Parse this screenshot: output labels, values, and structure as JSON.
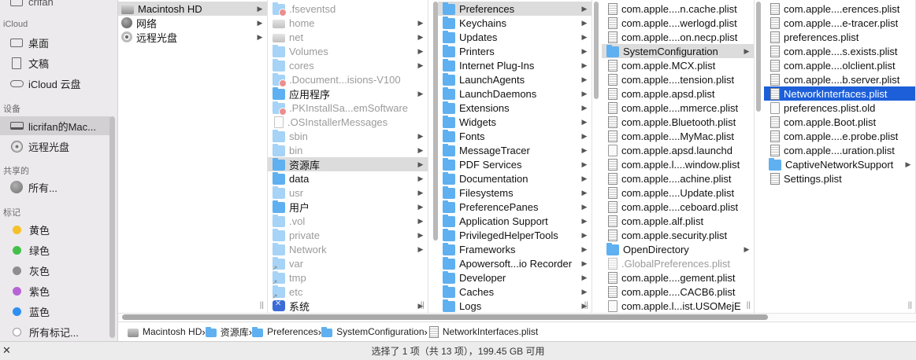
{
  "sidebar": {
    "top_partial": "crifan",
    "icloud_heading": "iCloud",
    "icloud": [
      {
        "label": "桌面",
        "icon": "desktop-icon"
      },
      {
        "label": "文稿",
        "icon": "document-icon"
      },
      {
        "label": "iCloud 云盘",
        "icon": "cloud-icon"
      }
    ],
    "devices_heading": "设备",
    "devices": [
      {
        "label": "licrifan的Mac...",
        "icon": "laptop-icon"
      },
      {
        "label": "远程光盘",
        "icon": "disc-icon"
      }
    ],
    "shared_heading": "共享的",
    "shared": [
      {
        "label": "所有...",
        "icon": "network-icon"
      }
    ],
    "tags_heading": "标记",
    "tags": [
      {
        "label": "黄色",
        "color": "#f6c02a"
      },
      {
        "label": "绿色",
        "color": "#44c04a"
      },
      {
        "label": "灰色",
        "color": "#8e8e8e"
      },
      {
        "label": "紫色",
        "color": "#b763d6"
      },
      {
        "label": "蓝色",
        "color": "#2f8ff2"
      },
      {
        "label": "所有标记...",
        "color": ""
      }
    ]
  },
  "columns": [
    {
      "items": [
        {
          "name": "Macintosh HD",
          "icon": "disk",
          "arrow": true,
          "selected": "gray"
        },
        {
          "name": "网络",
          "icon": "network",
          "arrow": true
        },
        {
          "name": "远程光盘",
          "icon": "disc",
          "arrow": true
        }
      ]
    },
    {
      "items": [
        {
          "name": ".fseventsd",
          "icon": "folder-lock",
          "dim": true
        },
        {
          "name": "home",
          "icon": "disk",
          "dim": true,
          "arrow": true
        },
        {
          "name": "net",
          "icon": "disk",
          "dim": true,
          "arrow": true
        },
        {
          "name": "Volumes",
          "icon": "folder",
          "dim": true,
          "arrow": true
        },
        {
          "name": "cores",
          "icon": "folder",
          "dim": true,
          "arrow": true
        },
        {
          "name": ".Document...isions-V100",
          "icon": "folder-lock",
          "dim": true
        },
        {
          "name": "应用程序",
          "icon": "folder",
          "arrow": true
        },
        {
          "name": ".PKInstallSa...emSoftware",
          "icon": "folder-lock",
          "dim": true
        },
        {
          "name": ".OSInstallerMessages",
          "icon": "file",
          "dim": true
        },
        {
          "name": "sbin",
          "icon": "folder",
          "dim": true,
          "arrow": true
        },
        {
          "name": "bin",
          "icon": "folder",
          "dim": true,
          "arrow": true
        },
        {
          "name": "资源库",
          "icon": "folder",
          "arrow": true,
          "selected": "gray"
        },
        {
          "name": "data",
          "icon": "folder",
          "arrow": true
        },
        {
          "name": "usr",
          "icon": "folder",
          "dim": true,
          "arrow": true
        },
        {
          "name": "用户",
          "icon": "folder",
          "arrow": true
        },
        {
          "name": ".vol",
          "icon": "folder",
          "dim": true,
          "arrow": true
        },
        {
          "name": "private",
          "icon": "folder",
          "dim": true,
          "arrow": true
        },
        {
          "name": "Network",
          "icon": "folder",
          "dim": true,
          "arrow": true
        },
        {
          "name": "var",
          "icon": "alias",
          "dim": true
        },
        {
          "name": "tmp",
          "icon": "alias",
          "dim": true
        },
        {
          "name": "etc",
          "icon": "alias",
          "dim": true
        },
        {
          "name": "系统",
          "icon": "system",
          "arrow": true
        }
      ]
    },
    {
      "items": [
        {
          "name": "Preferences",
          "icon": "folder",
          "arrow": true,
          "selected": "gray"
        },
        {
          "name": "Keychains",
          "icon": "folder",
          "arrow": true
        },
        {
          "name": "Updates",
          "icon": "folder",
          "arrow": true
        },
        {
          "name": "Printers",
          "icon": "folder",
          "arrow": true
        },
        {
          "name": "Internet Plug-Ins",
          "icon": "folder",
          "arrow": true
        },
        {
          "name": "LaunchAgents",
          "icon": "folder",
          "arrow": true
        },
        {
          "name": "LaunchDaemons",
          "icon": "folder",
          "arrow": true
        },
        {
          "name": "Extensions",
          "icon": "folder",
          "arrow": true
        },
        {
          "name": "Widgets",
          "icon": "folder",
          "arrow": true
        },
        {
          "name": "Fonts",
          "icon": "folder",
          "arrow": true
        },
        {
          "name": "MessageTracer",
          "icon": "folder",
          "arrow": true
        },
        {
          "name": "PDF Services",
          "icon": "folder",
          "arrow": true
        },
        {
          "name": "Documentation",
          "icon": "folder",
          "arrow": true
        },
        {
          "name": "Filesystems",
          "icon": "folder",
          "arrow": true
        },
        {
          "name": "PreferencePanes",
          "icon": "folder",
          "arrow": true
        },
        {
          "name": "Application Support",
          "icon": "folder",
          "arrow": true
        },
        {
          "name": "PrivilegedHelperTools",
          "icon": "folder",
          "arrow": true
        },
        {
          "name": "Frameworks",
          "icon": "folder",
          "arrow": true
        },
        {
          "name": "Apowersoft...io Recorder",
          "icon": "folder",
          "arrow": true
        },
        {
          "name": "Developer",
          "icon": "folder",
          "arrow": true
        },
        {
          "name": "Caches",
          "icon": "folder",
          "arrow": true
        },
        {
          "name": "Logs",
          "icon": "folder",
          "arrow": true
        }
      ]
    },
    {
      "items": [
        {
          "name": "com.apple....n.cache.plist",
          "icon": "plist"
        },
        {
          "name": "com.apple....werlogd.plist",
          "icon": "plist"
        },
        {
          "name": "com.apple....on.necp.plist",
          "icon": "plist"
        },
        {
          "name": "SystemConfiguration",
          "icon": "folder",
          "arrow": true,
          "selected": "gray"
        },
        {
          "name": "com.apple.MCX.plist",
          "icon": "plist"
        },
        {
          "name": "com.apple....tension.plist",
          "icon": "plist"
        },
        {
          "name": "com.apple.apsd.plist",
          "icon": "plist"
        },
        {
          "name": "com.apple....mmerce.plist",
          "icon": "plist"
        },
        {
          "name": "com.apple.Bluetooth.plist",
          "icon": "plist"
        },
        {
          "name": "com.apple....MyMac.plist",
          "icon": "plist"
        },
        {
          "name": "com.apple.apsd.launchd",
          "icon": "file"
        },
        {
          "name": "com.apple.l....window.plist",
          "icon": "plist"
        },
        {
          "name": "com.apple....achine.plist",
          "icon": "plist"
        },
        {
          "name": "com.apple....Update.plist",
          "icon": "plist"
        },
        {
          "name": "com.apple....ceboard.plist",
          "icon": "plist"
        },
        {
          "name": "com.apple.alf.plist",
          "icon": "plist"
        },
        {
          "name": "com.apple.security.plist",
          "icon": "plist"
        },
        {
          "name": "OpenDirectory",
          "icon": "folder",
          "arrow": true
        },
        {
          "name": ".GlobalPreferences.plist",
          "icon": "plist",
          "dim": true
        },
        {
          "name": "com.apple....gement.plist",
          "icon": "plist"
        },
        {
          "name": "com.apple....CACB6.plist",
          "icon": "plist"
        },
        {
          "name": "com.apple.l...ist.USOMejE",
          "icon": "file"
        }
      ]
    },
    {
      "items": [
        {
          "name": "com.apple....erences.plist",
          "icon": "plist"
        },
        {
          "name": "com.apple....e-tracer.plist",
          "icon": "plist"
        },
        {
          "name": "preferences.plist",
          "icon": "plist"
        },
        {
          "name": "com.apple....s.exists.plist",
          "icon": "plist"
        },
        {
          "name": "com.apple....olclient.plist",
          "icon": "plist"
        },
        {
          "name": "com.apple....b.server.plist",
          "icon": "plist"
        },
        {
          "name": "NetworkInterfaces.plist",
          "icon": "plist",
          "selected": "blue"
        },
        {
          "name": "preferences.plist.old",
          "icon": "file"
        },
        {
          "name": "com.apple.Boot.plist",
          "icon": "plist"
        },
        {
          "name": "com.apple....e.probe.plist",
          "icon": "plist"
        },
        {
          "name": "com.apple....uration.plist",
          "icon": "plist"
        },
        {
          "name": "CaptiveNetworkSupport",
          "icon": "folder",
          "arrow": true
        },
        {
          "name": "Settings.plist",
          "icon": "plist"
        }
      ]
    }
  ],
  "pathbar": [
    {
      "label": "Macintosh HD",
      "icon": "disk"
    },
    {
      "label": "资源库",
      "icon": "folder"
    },
    {
      "label": "Preferences",
      "icon": "folder"
    },
    {
      "label": "SystemConfiguration",
      "icon": "folder"
    },
    {
      "label": "NetworkInterfaces.plist",
      "icon": "plist"
    }
  ],
  "status": "选择了 1 项（共 13 项），199.45 GB 可用",
  "colors": {
    "selection_blue": "#1d5fd9",
    "folder_blue": "#5fb0f0",
    "sidebar_bg": "#eceaec"
  }
}
